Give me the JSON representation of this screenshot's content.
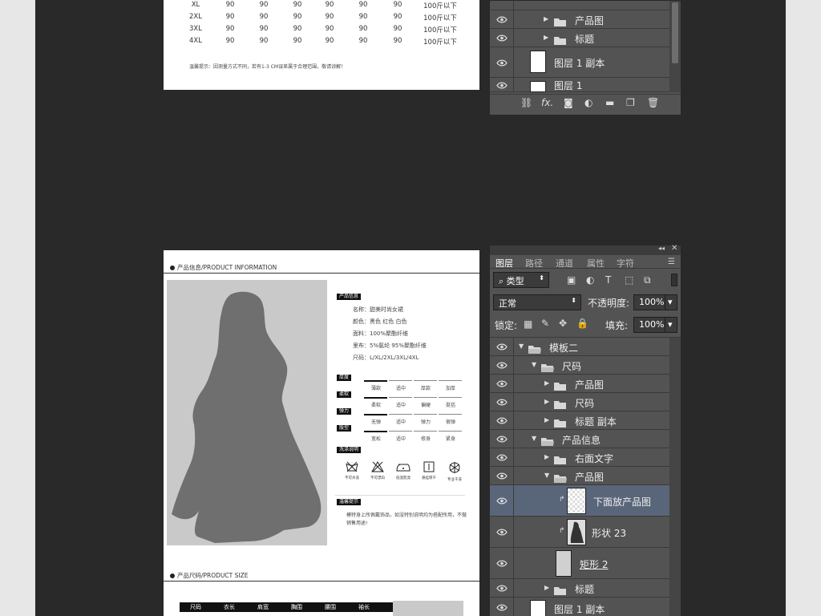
{
  "doc1": {
    "size_rows": [
      {
        "size": "XL",
        "cols": [
          "90",
          "90",
          "90",
          "90",
          "90",
          "90"
        ],
        "weight": "100斤以下"
      },
      {
        "size": "2XL",
        "cols": [
          "90",
          "90",
          "90",
          "90",
          "90",
          "90"
        ],
        "weight": "100斤以下"
      },
      {
        "size": "3XL",
        "cols": [
          "90",
          "90",
          "90",
          "90",
          "90",
          "90"
        ],
        "weight": "100斤以下"
      },
      {
        "size": "4XL",
        "cols": [
          "90",
          "90",
          "90",
          "90",
          "90",
          "90"
        ],
        "weight": "100斤以下"
      }
    ],
    "tip": "温馨提示：因测量方式不同，若有1-3 CM误差属于合理范围，敬请谅解！"
  },
  "doc2": {
    "section_info": "产品信息/PRODUCT INFORMATION",
    "section_size": "产品尺码/PRODUCT SIZE",
    "info_badge": "产品信息",
    "info_lines": [
      "名称：甜美时尚女裙",
      "颜色：黑色 红色 白色",
      "面料：100%聚酯纤维",
      "里布：5%氨纶  95%聚酯纤维",
      "尺码：L/XL/2XL/3XL/4XL"
    ],
    "scales": [
      {
        "label": "厚度",
        "options": [
          "薄款",
          "适中",
          "厚款",
          "加厚"
        ]
      },
      {
        "label": "柔软",
        "options": [
          "柔软",
          "适中",
          "偏硬",
          "挺括"
        ]
      },
      {
        "label": "弹力",
        "options": [
          "无弹",
          "适中",
          "弹力",
          "很弹"
        ]
      },
      {
        "label": "版型",
        "options": [
          "宽松",
          "适中",
          "修身",
          "紧身"
        ]
      }
    ],
    "wash_badge": "洗涤说明",
    "wash_items": [
      "不可水洗",
      "不可漂白",
      "低温熨烫",
      "悬挂晾干",
      "专业干洗"
    ],
    "care_badge": "温馨提示",
    "care_text": "模特身上所佩戴饰品，如没特别说明均为搭配所用，不做销售用途!",
    "size_headers": [
      "尺码",
      "衣长",
      "肩宽",
      "胸围",
      "腰围",
      "袖长"
    ]
  },
  "panel1": {
    "layers": [
      {
        "name": "产品图",
        "type": "folder"
      },
      {
        "name": "标题",
        "type": "folder"
      },
      {
        "name": "图层 1 副本",
        "type": "layer"
      },
      {
        "name": "图层 1",
        "type": "layer"
      }
    ]
  },
  "panel2": {
    "tabs": [
      "图层",
      "路径",
      "通道",
      "属性",
      "字符"
    ],
    "filter_label": "类型",
    "blend_mode": "正常",
    "opacity_label": "不透明度:",
    "opacity_value": "100%",
    "lock_label": "锁定:",
    "fill_label": "填充:",
    "fill_value": "100%",
    "layers": [
      {
        "name": "模板二",
        "type": "folder-open"
      },
      {
        "name": "尺码",
        "type": "folder-open"
      },
      {
        "name": "产品图",
        "type": "folder"
      },
      {
        "name": "尺码",
        "type": "folder"
      },
      {
        "name": "标题 副本",
        "type": "folder"
      },
      {
        "name": "产品信息",
        "type": "folder-open"
      },
      {
        "name": "右面文字",
        "type": "folder"
      },
      {
        "name": "产品图",
        "type": "folder-open"
      },
      {
        "name": "下面放产品图",
        "type": "smart",
        "selected": true
      },
      {
        "name": "形状 23",
        "type": "shape"
      },
      {
        "name": "矩形 2",
        "type": "rect"
      },
      {
        "name": "标题",
        "type": "folder"
      },
      {
        "name": "图层 1 副本",
        "type": "layer"
      }
    ]
  },
  "colors": {
    "canvas": "#292929",
    "panel": "#535353",
    "selected": "#59667a",
    "photo_bg": "#c9c9c9",
    "silhouette": "#6f6f6f"
  }
}
